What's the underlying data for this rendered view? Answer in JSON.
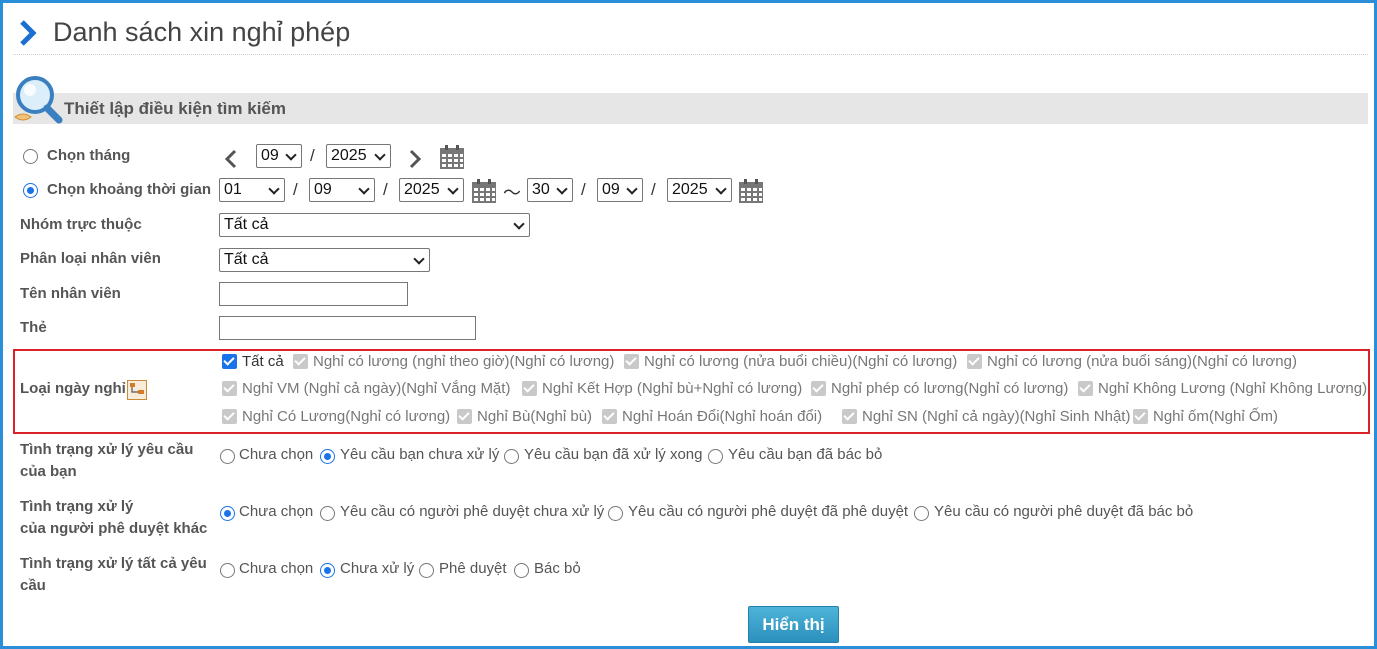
{
  "page": {
    "title": "Danh sách xin nghỉ phép"
  },
  "section": {
    "title": "Thiết lập điều kiện tìm kiếm"
  },
  "filters": {
    "month_mode": {
      "label": "Chọn tháng",
      "month": "09",
      "year": "2025",
      "selected": false
    },
    "range_mode": {
      "label": "Chọn khoảng thời gian",
      "selected": true,
      "from_day": "01",
      "from_month": "09",
      "from_year": "2025",
      "to_day": "30",
      "to_month": "09",
      "to_year": "2025"
    },
    "group": {
      "label": "Nhóm trực thuộc",
      "value": "Tất cả"
    },
    "employee_type": {
      "label": "Phân loại nhân viên",
      "value": "Tất cả"
    },
    "employee_name": {
      "label": "Tên nhân viên",
      "value": ""
    },
    "card": {
      "label": "Thẻ",
      "value": ""
    },
    "separator": "/",
    "range_sep": "～"
  },
  "leave_types": {
    "label": "Loại ngày nghỉ",
    "items": [
      {
        "label": "Tất cả",
        "checked": true
      },
      {
        "label": "Nghỉ có lương (nghỉ theo giờ)(Nghỉ có lương)",
        "checked": false
      },
      {
        "label": "Nghỉ có lương (nửa buổi chiều)(Nghỉ có lương)",
        "checked": false
      },
      {
        "label": "Nghỉ có lương (nửa buổi sáng)(Nghỉ có lương)",
        "checked": false
      },
      {
        "label": "Nghỉ VM (Nghỉ cả ngày)(Nghỉ Vắng Mặt)",
        "checked": false
      },
      {
        "label": "Nghỉ Kết Hợp (Nghỉ bù+Nghỉ có lương)",
        "checked": false
      },
      {
        "label": "Nghỉ phép có lương(Nghỉ có lương)",
        "checked": false
      },
      {
        "label": "Nghỉ Không Lương (Nghỉ Không Lương)",
        "checked": false
      },
      {
        "label": "Nghỉ Có Lương(Nghỉ có lương)",
        "checked": false
      },
      {
        "label": "Nghỉ Bù(Nghỉ bù)",
        "checked": false
      },
      {
        "label": "Nghỉ Hoán Đổi(Nghỉ hoán đổi)",
        "checked": false
      },
      {
        "label": "Nghỉ SN (Nghỉ cả ngày)(Nghỉ Sinh Nhật)",
        "checked": false
      },
      {
        "label": "Nghỉ ốm(Nghỉ Ốm)",
        "checked": false
      }
    ]
  },
  "status_mine": {
    "label_line1": "Tình trạng xử lý yêu cầu",
    "label_line2": "của bạn",
    "options": [
      "Chưa chọn",
      "Yêu cầu bạn chưa xử lý",
      "Yêu cầu bạn đã xử lý xong",
      "Yêu cầu bạn đã bác bỏ"
    ],
    "selected_index": 1
  },
  "status_others": {
    "label_line1": "Tình trạng xử lý",
    "label_line2": "của người phê duyệt khác",
    "options": [
      "Chưa chọn",
      "Yêu cầu có người phê duyệt chưa xử lý",
      "Yêu cầu có người phê duyệt đã phê duyệt",
      "Yêu cầu có người phê duyệt đã bác bỏ"
    ],
    "selected_index": 0
  },
  "status_all": {
    "label_line1": "Tình trạng xử lý tất cả yêu",
    "label_line2": "cầu",
    "options": [
      "Chưa chọn",
      "Chưa xử lý",
      "Phê duyệt",
      "Bác bỏ"
    ],
    "selected_index": 1
  },
  "actions": {
    "show_label": "Hiển thị"
  },
  "colors": {
    "accent": "#1a73e8",
    "frame": "#2a8fd8",
    "highlight": "#d9232b",
    "button": "#3aa2cb"
  }
}
